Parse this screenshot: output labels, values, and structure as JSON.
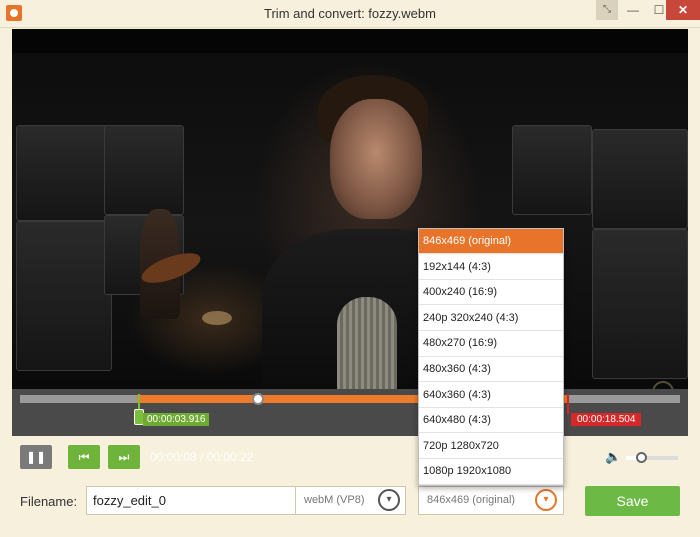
{
  "window": {
    "title": "Trim and convert: fozzy.webm",
    "controls": {
      "expand": "⤡",
      "minimize": "—",
      "maximize": "☐",
      "close": "✕"
    }
  },
  "player": {
    "trim_start": "00:00:03.916",
    "trim_end": "00:00:18.504",
    "time_display": "00:00:08 / 00:00:22",
    "trim_start_fraction": 0.177,
    "trim_end_fraction": 0.829,
    "playhead_fraction": 0.366,
    "volume_fraction": 0.3,
    "buttons": {
      "pause": "❚❚",
      "prev": "⏮",
      "next": "⏭",
      "volume": "🔈"
    }
  },
  "bottom": {
    "filename_label": "Filename:",
    "filename_value": "fozzy_edit_0",
    "format_value": "webM (VP8)",
    "resolution_value": "846x469 (original)",
    "save_label": "Save"
  },
  "resolution_options": [
    "846x469 (original)",
    "192x144 (4:3)",
    "400x240 (16:9)",
    "240p 320x240 (4:3)",
    "480x270 (16:9)",
    "480x360 (4:3)",
    "640x360 (4:3)",
    "640x480 (4:3)",
    "720p 1280x720",
    "1080p 1920x1080"
  ],
  "selected_resolution_index": 0,
  "colors": {
    "accent": "#e8742a",
    "green": "#6cba45",
    "trim_end": "#d62828"
  },
  "icons": {
    "chevron": "▾"
  }
}
